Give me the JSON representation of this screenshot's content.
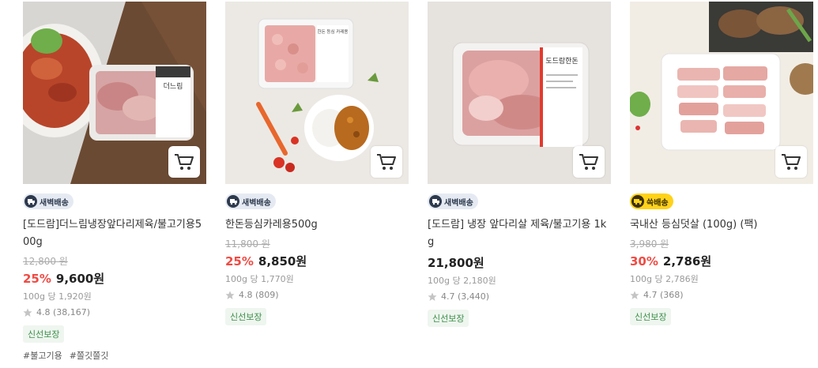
{
  "products": [
    {
      "delivery_badge": "새벽배송",
      "badge_type": "dawn",
      "name": "[도드람]더느림냉장앞다리제육/불고기용500g",
      "original_price": "12,800 원",
      "discount": "25%",
      "price": "9,600원",
      "unit_price": "100g 당 1,920원",
      "rating": "4.8 (38,167)",
      "fresh_label": "신선보장",
      "tags": [
        "#불고기용",
        "#쫄깃쫄깃"
      ],
      "package_label": "더느림"
    },
    {
      "delivery_badge": "새벽배송",
      "badge_type": "dawn",
      "name": "한돈등심카레용500g",
      "original_price": "11,800 원",
      "discount": "25%",
      "price": "8,850원",
      "unit_price": "100g 당 1,770원",
      "rating": "4.8 (809)",
      "fresh_label": "신선보장",
      "tags": [],
      "package_label": "한돈 등심 카레용"
    },
    {
      "delivery_badge": "새벽배송",
      "badge_type": "dawn",
      "name": "[도드람] 냉장 앞다리살 제육/불고기용 1kg",
      "original_price": "",
      "discount": "",
      "price": "21,800원",
      "unit_price": "100g 당 2,180원",
      "rating": "4.7 (3,440)",
      "fresh_label": "신선보장",
      "tags": [],
      "package_label": "도드람한돈"
    },
    {
      "delivery_badge": "쓱배송",
      "badge_type": "fast",
      "name": "국내산 등심덧살 (100g) (팩)",
      "original_price": "3,980 원",
      "discount": "30%",
      "price": "2,786원",
      "unit_price": "100g 당 2,786원",
      "rating": "4.7 (368)",
      "fresh_label": "신선보장",
      "tags": [],
      "package_label": ""
    }
  ],
  "icons": {
    "cart": "cart-icon",
    "star": "star-icon",
    "dawn_delivery": "dawn-truck-icon",
    "fast_delivery": "fast-truck-icon"
  },
  "colors": {
    "discount": "#f04b43",
    "dawn_badge_bg": "#e5eaf2",
    "fast_badge_bg": "#ffd21a",
    "fresh_text": "#3d8e4a"
  }
}
